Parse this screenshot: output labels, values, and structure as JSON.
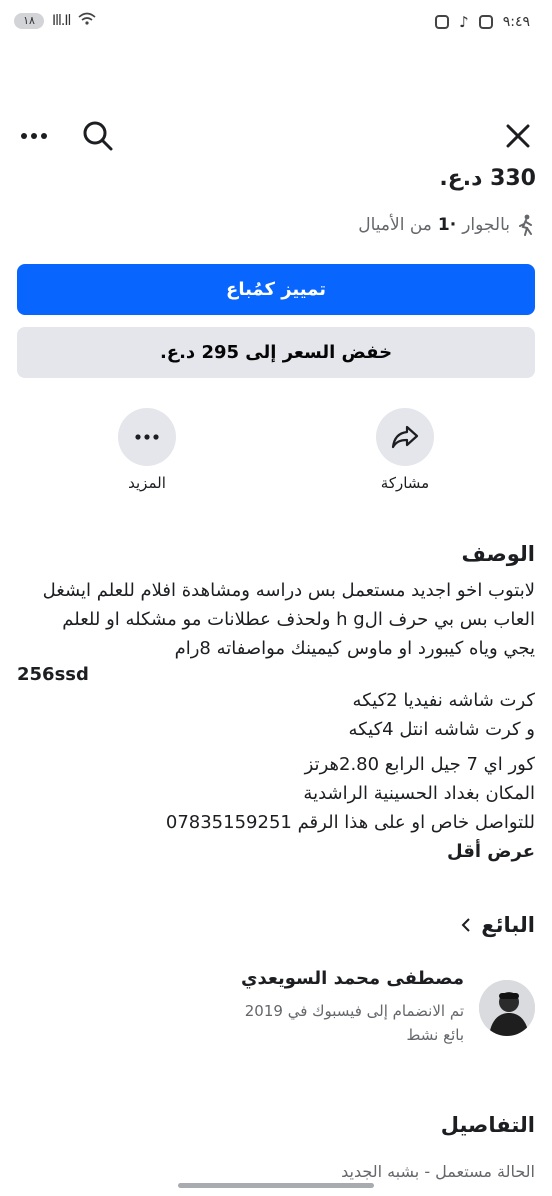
{
  "status_bar": {
    "time": "٩:٤٩",
    "battery": "١٨",
    "signal": "Ill.Il",
    "wifi_badge": "5"
  },
  "listing": {
    "price": "330 د.ع.",
    "distance_prefix": "بالجوار",
    "distance_value": "·1",
    "distance_unit": "من الأميال"
  },
  "buttons": {
    "boost_label": "تمييز كمُباع",
    "reduce_price_label": "خفض السعر إلى 295 د.ع."
  },
  "actions": {
    "share_label": "مشاركة",
    "more_label": "المزيد"
  },
  "description": {
    "title": "الوصف",
    "line1": "لابتوب اخو اجديد مستعمل بس دراسه ومشاهدة افلام للعلم ايشغل",
    "line2": "العاب  بس بي حرف الh g  ولحذف عطلانات مو مشكله او للعلم",
    "line3": "يجي وياه كيبورد او ماوس كيمينك مواصفاته 8رام",
    "line4": "256ssd",
    "line5": "كرت شاشه نفيديا 2كيكه",
    "line6": "و كرت شاشه انتل 4كيكه",
    "line7": "كور اي 7 جيل الرابع  2.80هرتز",
    "line8": "المكان بغداد الحسينية الراشدية",
    "line9": "للتواصل خاص او على هذا الرقم  07835159251",
    "show_less": "عرض أقل"
  },
  "seller": {
    "title": "البائع",
    "name": "مصطفى محمد السويعدي",
    "joined": "تم الانضمام إلى فيسبوك في 2019",
    "status": "بائع نشط"
  },
  "details": {
    "title": "التفاصيل",
    "row_cut_text": "الحالة                                   مستعمل - بشبه الجديد"
  },
  "icons": {
    "close": "close-icon",
    "search": "search-icon",
    "more": "more-dots-icon",
    "share": "share-arrow-icon",
    "walk": "walking-person-icon",
    "chevron": "chevron-left-icon"
  }
}
